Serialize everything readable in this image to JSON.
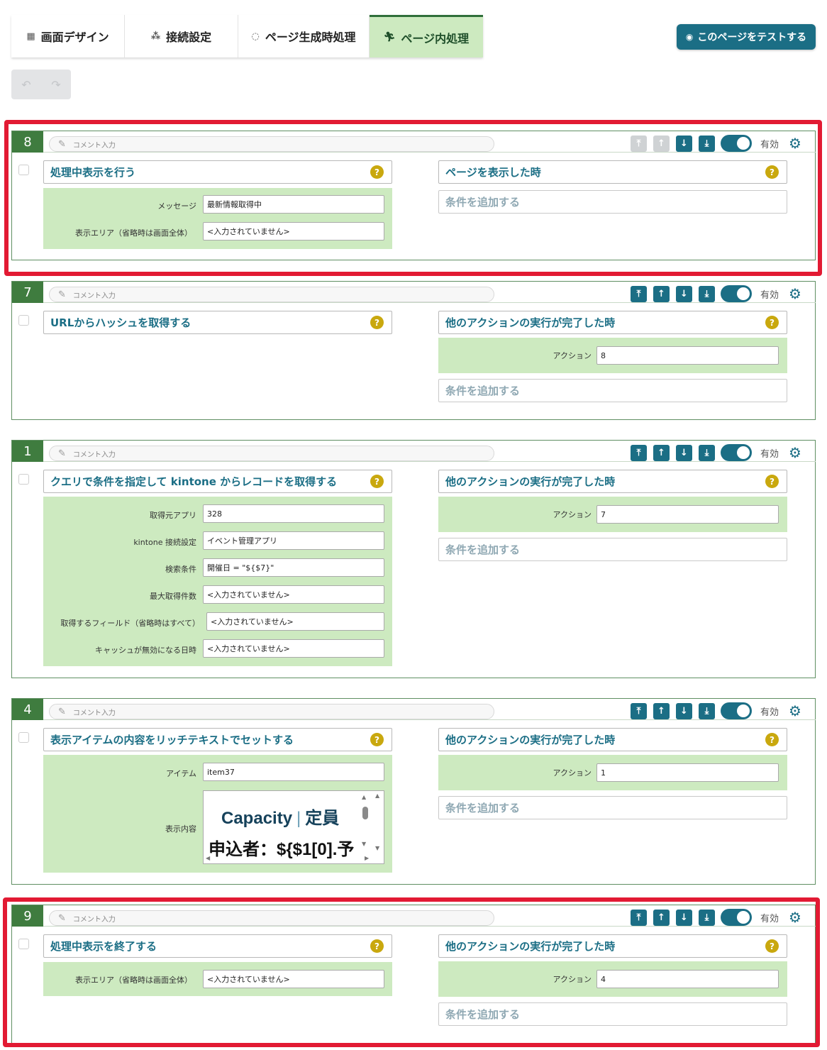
{
  "tabs": [
    {
      "label": "画面デザイン",
      "icon": "layout-icon",
      "active": false
    },
    {
      "label": "接続設定",
      "icon": "connection-icon",
      "active": false
    },
    {
      "label": "ページ生成時処理",
      "icon": "refresh-icon",
      "active": false
    },
    {
      "label": "ページ内処理",
      "icon": "running-icon",
      "active": true
    }
  ],
  "test_button": {
    "label": "このページをテストする",
    "icon": "eye-icon"
  },
  "common": {
    "comment_placeholder": "コメント入力",
    "enabled_label": "有効",
    "help": "?",
    "add_condition": "条件を追加する"
  },
  "cards": [
    {
      "number": "8",
      "tools_disabled_top": true,
      "action_title": "処理中表示を行う",
      "action_params": [
        {
          "label": "メッセージ",
          "value": "最新情報取得中"
        },
        {
          "label": "表示エリア（省略時は画面全体）",
          "value": "<入力されていません>"
        }
      ],
      "trigger_title": "ページを表示した時",
      "trigger_params": []
    },
    {
      "number": "7",
      "action_title": "URLからハッシュを取得する",
      "action_params": [],
      "trigger_title": "他のアクションの実行が完了した時",
      "trigger_params": [
        {
          "label": "アクション",
          "value": "8"
        }
      ]
    },
    {
      "number": "1",
      "action_title": "クエリで条件を指定して kintone からレコードを取得する",
      "action_params": [
        {
          "label": "取得元アプリ",
          "value": "328"
        },
        {
          "label": "kintone 接続設定",
          "value": "イベント管理アプリ"
        },
        {
          "label": "検索条件",
          "value": "開催日 = \"${$7}\""
        },
        {
          "label": "最大取得件数",
          "value": "<入力されていません>"
        },
        {
          "label": "取得するフィールド（省略時はすべて）",
          "value": "<入力されていません>"
        },
        {
          "label": "キャッシュが無効になる日時",
          "value": "<入力されていません>"
        }
      ],
      "trigger_title": "他のアクションの実行が完了した時",
      "trigger_params": [
        {
          "label": "アクション",
          "value": "7"
        }
      ]
    },
    {
      "number": "4",
      "action_title": "表示アイテムの内容をリッチテキストでセットする",
      "action_params": [
        {
          "label": "アイテム",
          "value": "item37"
        },
        {
          "label": "表示内容",
          "value": ""
        }
      ],
      "rich_text": {
        "line1_a": "Capacity",
        "line1_sep": "|",
        "line1_b": "定員",
        "line2": "申込者：${$1[0].予"
      },
      "trigger_title": "他のアクションの実行が完了した時",
      "trigger_params": [
        {
          "label": "アクション",
          "value": "1"
        }
      ]
    },
    {
      "number": "9",
      "action_title": "処理中表示を終了する",
      "action_params": [
        {
          "label": "表示エリア（省略時は画面全体）",
          "value": "<入力されていません>"
        }
      ],
      "trigger_title": "他のアクションの実行が完了した時",
      "trigger_params": [
        {
          "label": "アクション",
          "value": "4"
        }
      ]
    }
  ],
  "colors": {
    "accent": "#1b6e85",
    "green": "#3f7c3f",
    "param_bg": "#cdeac0",
    "highlight": "#e21a33",
    "help": "#c9a80e"
  }
}
